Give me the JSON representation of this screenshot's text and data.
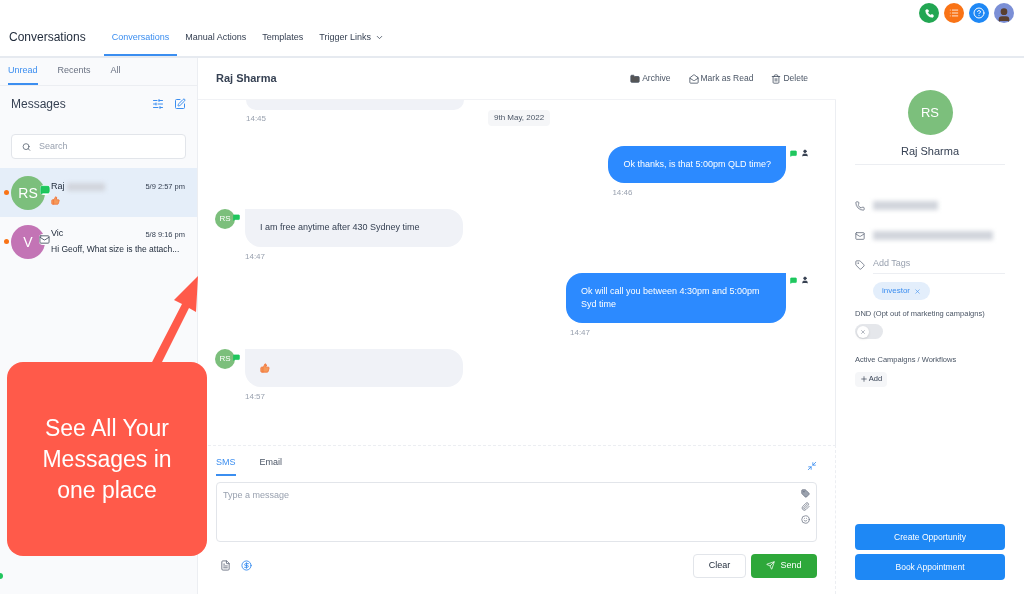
{
  "header": {
    "title": "Conversations",
    "tabs": [
      {
        "label": "Conversations",
        "selected": true,
        "dropdown": false
      },
      {
        "label": "Manual Actions",
        "selected": false,
        "dropdown": false
      },
      {
        "label": "Templates",
        "selected": false,
        "dropdown": false
      },
      {
        "label": "Trigger Links",
        "selected": false,
        "dropdown": true
      }
    ]
  },
  "sidebar": {
    "filters": [
      {
        "label": "Unread",
        "selected": true
      },
      {
        "label": "Recents",
        "selected": false
      },
      {
        "label": "All",
        "selected": false
      }
    ],
    "heading": "Messages",
    "search": {
      "placeholder": "Search"
    },
    "conversations": [
      {
        "kind": "thumbs_up",
        "initials": "RS",
        "name": "Raj",
        "name_redacted": true,
        "time": "5/9 2:57 pm",
        "channel": {
          "kind": "sms"
        },
        "unread": true,
        "selected": true,
        "color": "#7cbf7c"
      },
      {
        "kind": "text",
        "initials": "V",
        "name": "Vic",
        "name_redacted": false,
        "time": "5/8 9:16 pm",
        "preview": "Hi Geoff, What size is the attach...",
        "channel": {
          "kind": "email"
        },
        "unread": true,
        "selected": false,
        "color": "#c374b5"
      }
    ]
  },
  "chat": {
    "contact_name": "Raj Sharma",
    "actions": [
      {
        "kind": "archive",
        "label": "Archive"
      },
      {
        "kind": "read",
        "label": "Mark as Read"
      },
      {
        "kind": "delete",
        "label": "Delete"
      }
    ],
    "items": [
      {
        "kind": "clipped",
        "outgoing": false,
        "time": "14:45",
        "date": "9th May, 2022"
      },
      {
        "kind": "text",
        "outgoing": true,
        "text": "Ok thanks, is that 5:00pm QLD time?",
        "time": "14:46"
      },
      {
        "kind": "text",
        "outgoing": false,
        "initials": "RS",
        "text": "I am free anytime after 430 Sydney time",
        "time": "14:47"
      },
      {
        "kind": "text",
        "outgoing": true,
        "text": "Ok will call you between 4:30pm and 5:00pm Syd time",
        "time": "14:47"
      },
      {
        "kind": "thumbs_up",
        "outgoing": false,
        "initials": "RS",
        "time": "14:57"
      }
    ],
    "composer": {
      "tabs": [
        {
          "label": "SMS",
          "selected": true
        },
        {
          "label": "Email",
          "selected": false
        }
      ],
      "placeholder": "Type a message",
      "buttons": [
        {
          "kind": "secondary",
          "label": "Clear"
        },
        {
          "kind": "send",
          "label": "Send"
        }
      ]
    }
  },
  "contact": {
    "initials": "RS",
    "name": "Raj Sharma",
    "tags_placeholder": "Add Tags",
    "tags": [
      "investor"
    ],
    "dnd_label": "DND (Opt out of marketing campaigns)",
    "dnd": false,
    "campaigns_label": "Active Campaigns / Workflows",
    "add_label": "Add",
    "buttons": [
      "Create Opportunity",
      "Book Appointment"
    ]
  },
  "callout": {
    "text": "See All Your Messages in one place"
  }
}
